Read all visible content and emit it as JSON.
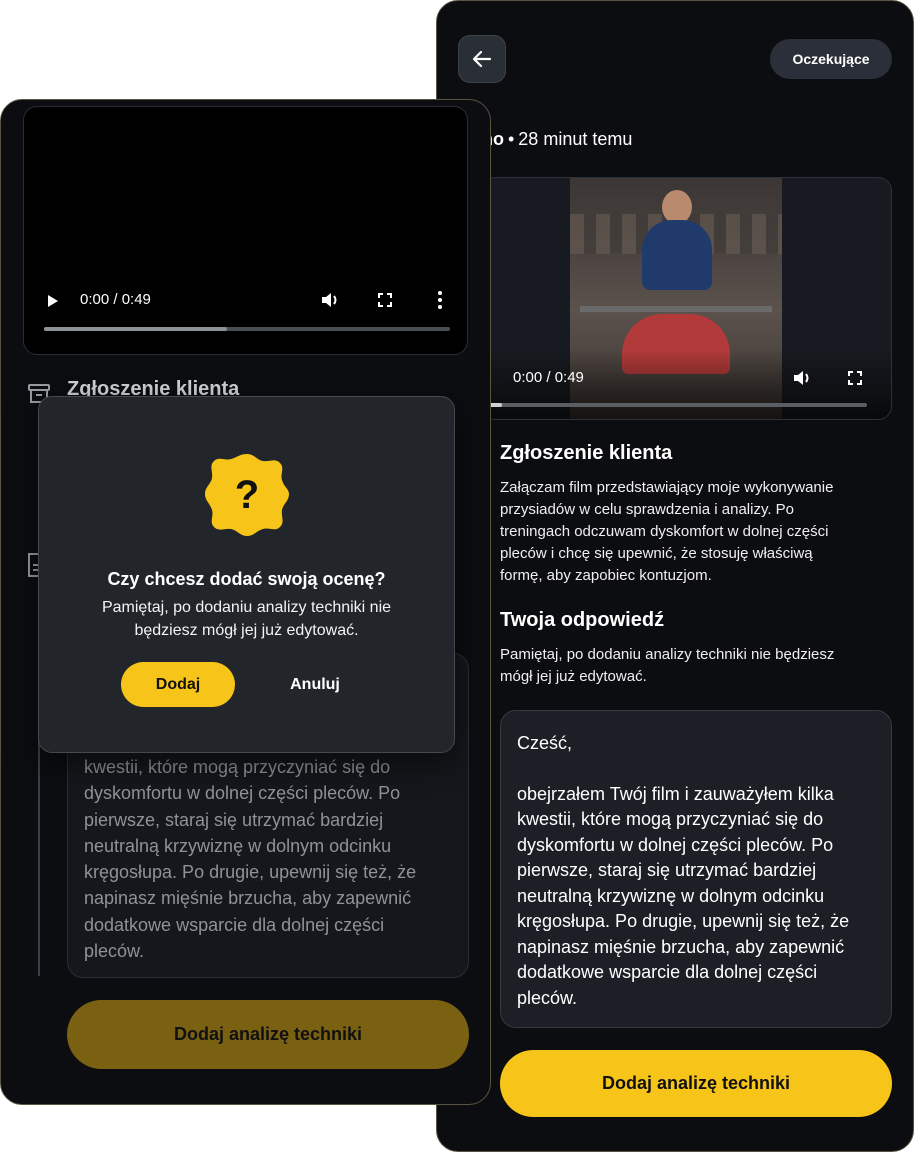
{
  "right_screen": {
    "status_badge": "Oczekujące",
    "created_label": "Utworzono",
    "created_separator": "•",
    "created_time": "28 minut temu",
    "video": {
      "time": "0:00 / 0:49",
      "progress": 0.0
    },
    "client_section": {
      "title": "Zgłoszenie klienta",
      "lines": [
        "Załączam film przedstawiający moje wykonywanie",
        "przysiadów w celu sprawdzenia i analizy. Po",
        "treningach odczuwam dyskomfort w dolnej części",
        "pleców i chcę się upewnić, że stosuję właściwą",
        "formę, aby zapobiec kontuzjom."
      ]
    },
    "reply_section": {
      "title": "Twoja odpowiedź",
      "lines": [
        "Pamiętaj, po dodaniu analizy techniki nie będziesz",
        "mógł jej już edytować."
      ]
    },
    "response": {
      "greeting": "Cześć,",
      "lines": [
        "obejrzałem Twój film i zauważyłem kilka",
        "kwestii, które mogą przyczyniać się do",
        "dyskomfortu w dolnej części pleców. Po",
        "pierwsze, staraj się utrzymać bardziej",
        "neutralną krzywiznę w dolnym odcinku",
        "kręgosłupa. Po drugie, upewnij się też, że",
        "napinasz mięśnie brzucha, aby zapewnić",
        "dodatkowe wsparcie dla dolnej części",
        "pleców."
      ]
    },
    "cta": "Dodaj analizę techniki"
  },
  "left_screen": {
    "video": {
      "time": "0:00 / 0:49",
      "buffered": 0.45
    },
    "section_title": "Zgłoszenie klienta",
    "response_lines": [
      "kwestii, które mogą przyczyniać się do",
      "dyskomfortu w dolnej części pleców. Po",
      "pierwsze, staraj się utrzymać bardziej",
      "neutralną krzywiznę w dolnym odcinku",
      "kręgosłupa. Po drugie, upewnij się też, że",
      "napinasz mięśnie brzucha, aby zapewnić",
      "dodatkowe wsparcie dla dolnej części",
      "pleców."
    ],
    "cta": "Dodaj analizę techniki",
    "modal": {
      "badge_symbol": "?",
      "title": "Czy chcesz dodać swoją ocenę?",
      "text_lines": [
        "Pamiętaj, po dodaniu analizy techniki nie",
        "będziesz mógł jej już edytować."
      ],
      "confirm": "Dodaj",
      "cancel": "Anuluj"
    }
  },
  "colors": {
    "accent": "#f7c51a",
    "background": "#0c0d10",
    "card": "#1c1f25",
    "muted_accent": "#7a6112"
  }
}
